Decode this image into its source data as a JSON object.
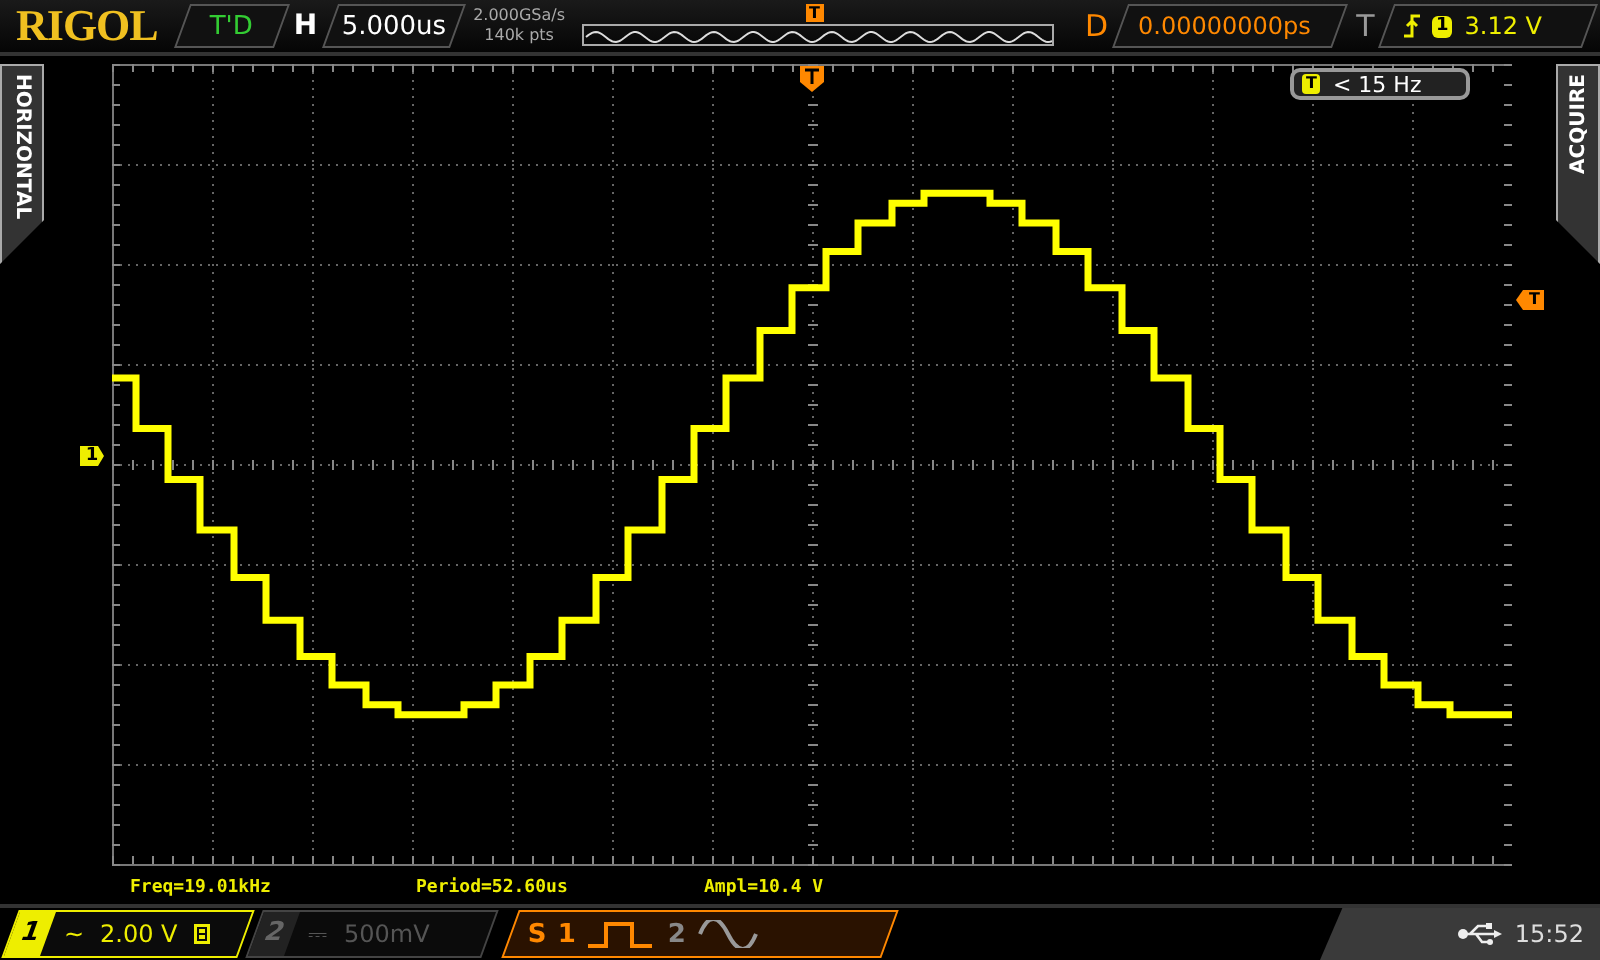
{
  "top_bar": {
    "brand": "RIGOL",
    "run_status": "T'D",
    "horizontal_label": "H",
    "timebase": "5.000us",
    "sample_rate": "2.000GSa/s",
    "memory_depth": "140k pts",
    "trigger_position_marker": "T",
    "delay_label": "D",
    "delay": "0.00000000ps",
    "trigger_label": "T",
    "trigger_source": "1",
    "trigger_level": "3.12 V"
  },
  "side_tabs": {
    "left": "HORIZONTAL",
    "right": "ACQUIRE"
  },
  "markers": {
    "channel": "1",
    "trigger_level": "T"
  },
  "frequency_counter": {
    "icon": "T",
    "value": "< 15 Hz"
  },
  "measurements": [
    {
      "text": "Freq=19.01kHz"
    },
    {
      "text": "Period=52.60us"
    },
    {
      "text": "Ampl=10.4 V"
    }
  ],
  "channels": [
    {
      "number": "1",
      "coupling": "~",
      "scale": "2.00 V",
      "enabled": true,
      "bandwidth_limit": true
    },
    {
      "number": "2",
      "coupling": "⎓",
      "scale": "500mV",
      "enabled": false,
      "bandwidth_limit": false
    }
  ],
  "math": {
    "label": "S",
    "source_1": "1",
    "source_2": "2"
  },
  "status": {
    "time": "15:52"
  }
}
